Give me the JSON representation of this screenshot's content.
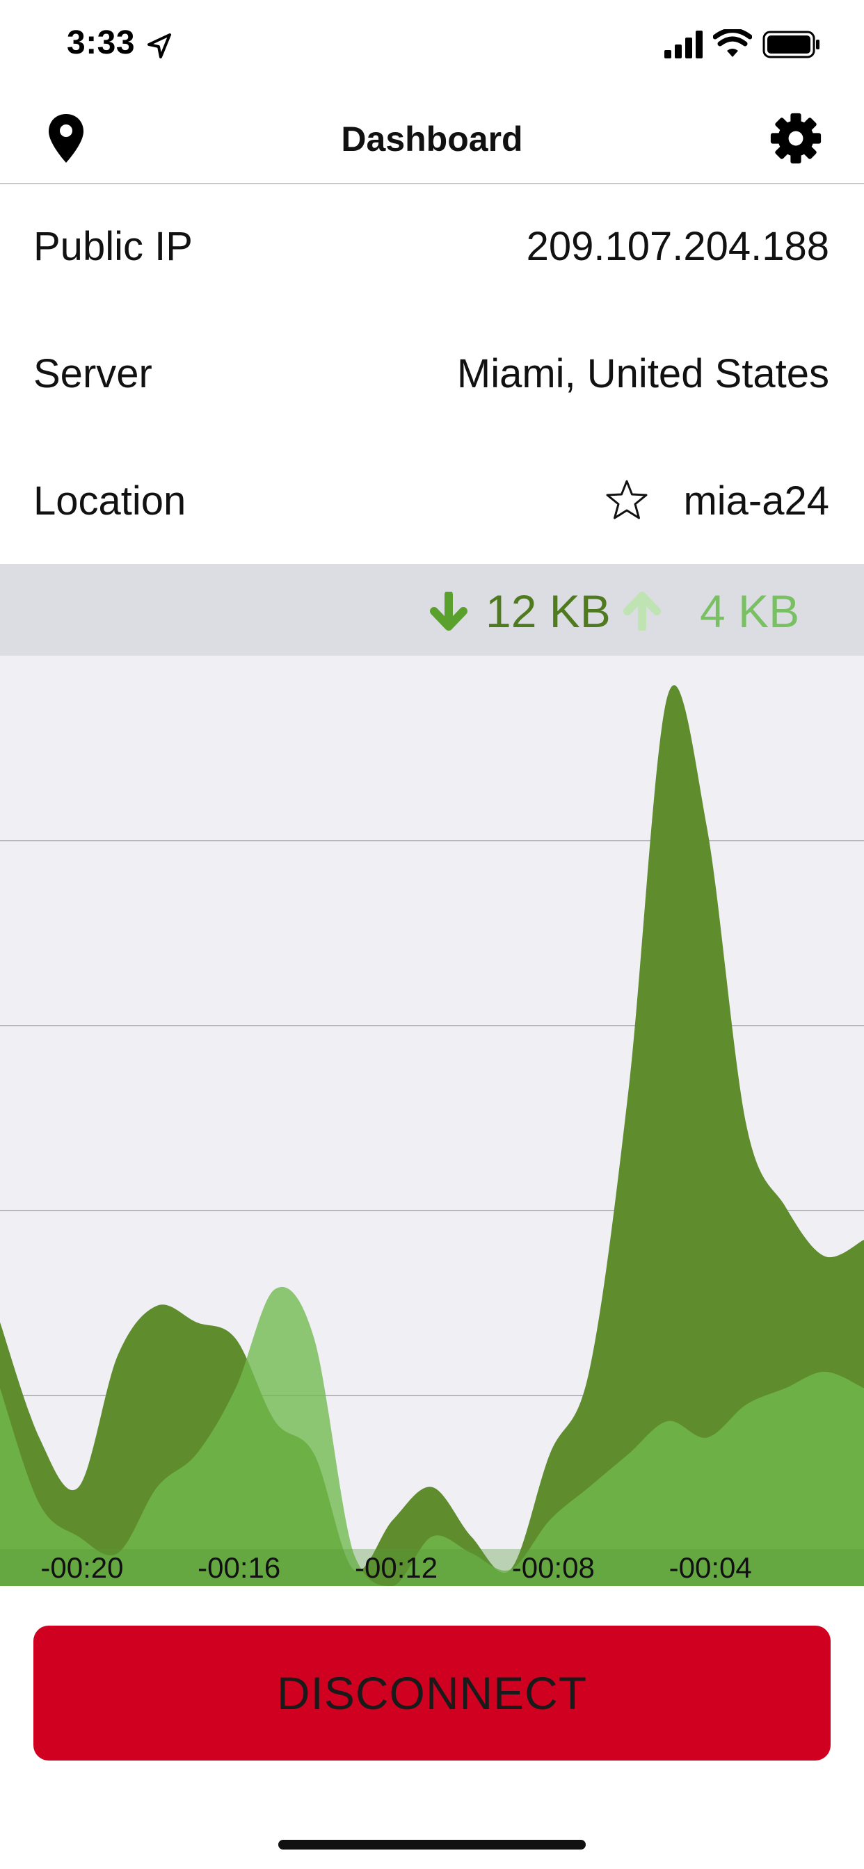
{
  "status_bar": {
    "time": "3:33"
  },
  "nav": {
    "title": "Dashboard"
  },
  "info": {
    "rows": [
      {
        "label": "Public IP",
        "value": "209.107.204.188"
      },
      {
        "label": "Server",
        "value": "Miami, United States"
      },
      {
        "label": "Location",
        "value": "mia-a24"
      }
    ]
  },
  "traffic": {
    "download": "12 KB",
    "upload": "4 KB"
  },
  "colors": {
    "download_fill": "#5f8c2d",
    "upload_fill": "#6fba4d",
    "upload_peak_fill": "#a9d79a",
    "disconnect_bg": "#cf0020",
    "chart_bg": "#efeff4"
  },
  "chart_data": {
    "type": "area",
    "x_ticks": [
      "-00:20",
      "-00:16",
      "-00:12",
      "-00:08",
      "-00:04"
    ],
    "x": [
      -22,
      -21,
      -20,
      -19,
      -18,
      -17,
      -16,
      -15,
      -14,
      -13,
      -12,
      -11,
      -10,
      -9,
      -8,
      -7,
      -6,
      -5,
      -4,
      -3,
      -2,
      -1,
      0
    ],
    "series": [
      {
        "values": [
          1.6,
          0.9,
          0.6,
          1.4,
          1.7,
          1.6,
          1.5,
          1.0,
          0.8,
          0.1,
          0.4,
          0.6,
          0.3,
          0.1,
          0.8,
          1.3,
          3.0,
          5.4,
          4.6,
          2.8,
          2.3,
          2.0,
          2.1
        ]
      },
      {
        "values": [
          1.2,
          0.5,
          0.3,
          0.2,
          0.6,
          0.8,
          1.2,
          1.8,
          1.5,
          0.2,
          0.0,
          0.3,
          0.2,
          0.1,
          0.4,
          0.6,
          0.8,
          1.0,
          0.9,
          1.1,
          1.2,
          1.3,
          1.2
        ]
      }
    ],
    "ylim": [
      0,
      5.6
    ],
    "grid": true,
    "legend": "none"
  },
  "actions": {
    "disconnect_label": "DISCONNECT"
  }
}
